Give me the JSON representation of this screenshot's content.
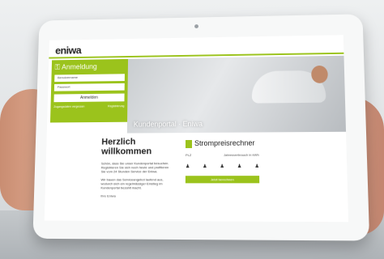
{
  "site": {
    "logo": "eniwa",
    "accent_color": "#9bc31c"
  },
  "login": {
    "title": "Anmeldung",
    "username_placeholder": "Benutzername",
    "password_placeholder": "Passwort",
    "button": "Anmelden",
    "link_forgot": "Zugangsdaten vergessen",
    "link_register": "Registrierung"
  },
  "hero": {
    "caption": "Kundenportal · Eniwa"
  },
  "welcome": {
    "heading": "Herzlich willkommen",
    "p1": "Schön, dass Sie unser Kundenportal besuchen. Registrieren Sie sich noch heute und profitieren Sie vom 24 Stunden Service der Eniwa.",
    "p2": "Wir bauen das Serviceangebot laufend aus, wodurch sich ein regelmässiger Einstieg im Kundenportal bezahlt macht.",
    "signature": "Ihre Eniwa"
  },
  "calculator": {
    "title": "Strompreisrechner",
    "label_plz": "PLZ",
    "label_consumption": "Jahresverbrauch in kWh",
    "people_icons": [
      "person-icon",
      "person-icon",
      "person-icon",
      "person-icon",
      "person-icon"
    ],
    "button": "Jetzt berechnen"
  }
}
